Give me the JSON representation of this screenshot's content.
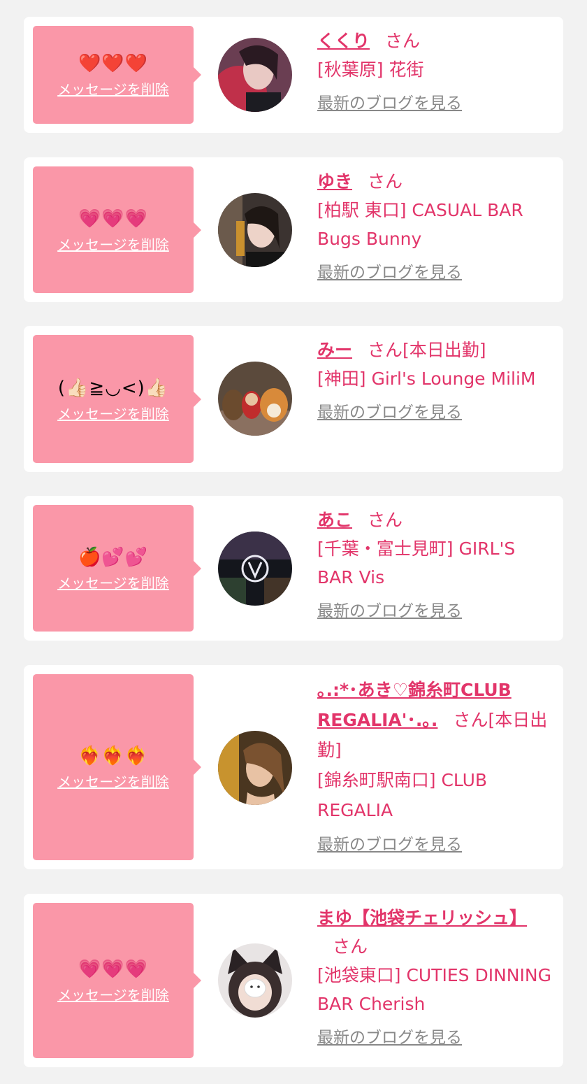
{
  "colors": {
    "accent": "#e2356a",
    "bubble": "#fa97a8",
    "link_gray": "#888888",
    "background": "#f2f2f2"
  },
  "favorites": [
    {
      "emoji": "❤️❤️❤️",
      "delete_label": "メッセージを削除",
      "name": "くくり",
      "suffix": "さん",
      "location": "[秋葉原] 花街",
      "blog_label": "最新のブログを見る"
    },
    {
      "emoji": "💗💗💗",
      "delete_label": "メッセージを削除",
      "name": "ゆき",
      "suffix": "さん",
      "location": "[柏駅 東口] CASUAL BAR Bugs Bunny",
      "blog_label": "最新のブログを見る"
    },
    {
      "emoji": "(👍🏻≧◡<)👍🏻",
      "delete_label": "メッセージを削除",
      "name": "みー",
      "suffix": "さん[本日出勤]",
      "location": "[神田] Girl's Lounge MiliM",
      "blog_label": "最新のブログを見る"
    },
    {
      "emoji": "🍎💕💕",
      "delete_label": "メッセージを削除",
      "name": "あこ",
      "suffix": "さん",
      "location": "[千葉・富士見町] GIRL'S BAR Vis",
      "blog_label": "最新のブログを見る"
    },
    {
      "emoji": "❤️‍🔥❤️‍🔥❤️‍🔥",
      "delete_label": "メッセージを削除",
      "name": "｡.:*･あき♡錦糸町CLUB REGALIA'･.｡.",
      "suffix": "さん[本日出勤]",
      "location": "[錦糸町駅南口] CLUB REGALIA",
      "blog_label": "最新のブログを見る"
    },
    {
      "emoji": "💗💗💗",
      "delete_label": "メッセージを削除",
      "name": "まゆ【池袋チェリッシュ】",
      "suffix": "さん",
      "location": "[池袋東口] CUTIES DINNING BAR Cherish",
      "blog_label": "最新のブログを見る"
    }
  ]
}
